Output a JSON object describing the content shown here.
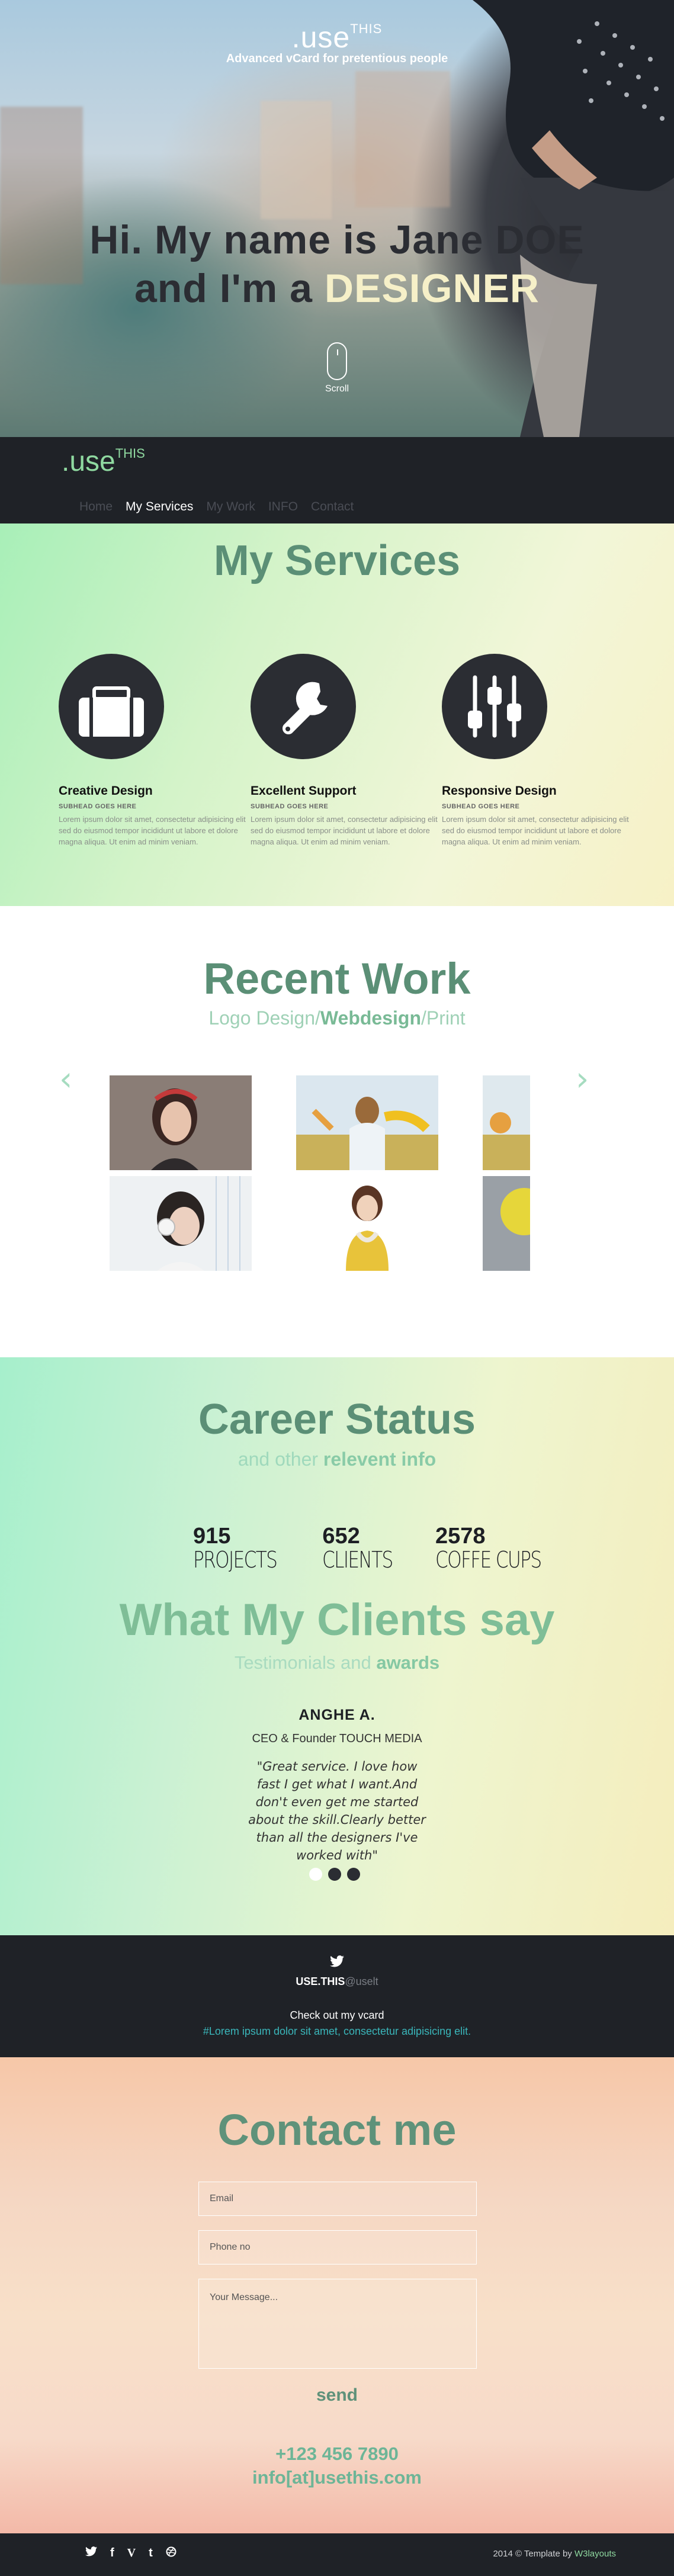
{
  "hero": {
    "brand": ".use",
    "brand_sup": "THIS",
    "tagline": "Advanced vCard for pretentious people",
    "title_line1": "Hi. My name is Jane DOE",
    "title_line2_prefix": "and I'm a ",
    "title_line2_accent": "DESIGNER",
    "scroll_label": "Scroll"
  },
  "nav": {
    "brand": ".use",
    "brand_sup": "THIS",
    "links": [
      "Home",
      "My Services",
      "My Work",
      "INFO",
      "Contact"
    ],
    "active_index": 1
  },
  "services": {
    "title": "My Services",
    "items": [
      {
        "icon": "briefcase-icon",
        "title": "Creative Design",
        "subhead": "SUBHEAD GOES HERE",
        "text": "Lorem ipsum dolor sit amet, consectetur adipisicing elit sed do eiusmod tempor incididunt ut labore et dolore magna aliqua. Ut enim ad minim veniam."
      },
      {
        "icon": "wrench-icon",
        "title": "Excellent Support",
        "subhead": "SUBHEAD GOES HERE",
        "text": "Lorem ipsum dolor sit amet, consectetur adipisicing elit sed do eiusmod tempor incididunt ut labore et dolore magna aliqua. Ut enim ad minim veniam."
      },
      {
        "icon": "sliders-icon",
        "title": "Responsive Design",
        "subhead": "SUBHEAD GOES HERE",
        "text": "Lorem ipsum dolor sit amet, consectetur adipisicing elit sed do eiusmod tempor incididunt ut labore et dolore magna aliqua. Ut enim ad minim veniam."
      }
    ]
  },
  "work": {
    "title": "Recent Work",
    "filter_1": "Logo Design",
    "filter_sep1": "/",
    "filter_2": "Webdesign",
    "filter_sep2": "/",
    "filter_3": "Print",
    "prev_icon": "chevron-left-icon",
    "next_icon": "chevron-right-icon"
  },
  "career": {
    "title": "Career Status",
    "sub_prefix": "and other ",
    "sub_bold": "relevent info",
    "stats": [
      {
        "num": "915",
        "label": "PROJECTS"
      },
      {
        "num": "652",
        "label": "CLIENTS"
      },
      {
        "num": "2578",
        "label": "COFFE CUPS"
      }
    ]
  },
  "clients": {
    "title": "What My Clients say",
    "sub_prefix": "Testimonials and ",
    "sub_bold": "awards",
    "name": "ANGHE A.",
    "role": "CEO & Founder TOUCH MEDIA",
    "quote": "\"Great service. I love how fast I get what I want.And don't even get me started about the skill.Clearly better than all the designers I've worked with\"",
    "dots": 3,
    "active_dot": 0
  },
  "twitter": {
    "icon": "twitter-bird-icon",
    "handle": "USE.THIS",
    "handle_suffix": "@uselt",
    "message": "Check out my vcard",
    "link": "#Lorem ipsum dolor sit amet, consectetur adipisicing elit."
  },
  "contact": {
    "title": "Contact me",
    "email_placeholder": "Email",
    "phone_placeholder": "Phone no",
    "message_placeholder": "Your Message...",
    "send_label": "send",
    "phone": "+123 456 7890",
    "email": "info[at]usethis.com"
  },
  "footer": {
    "social_icons": [
      "twitter-icon",
      "facebook-icon",
      "vimeo-icon",
      "tumblr-icon",
      "dribbble-icon"
    ],
    "copyright_prefix": "2014 © Template by ",
    "copyright_link": "W3layouts"
  }
}
